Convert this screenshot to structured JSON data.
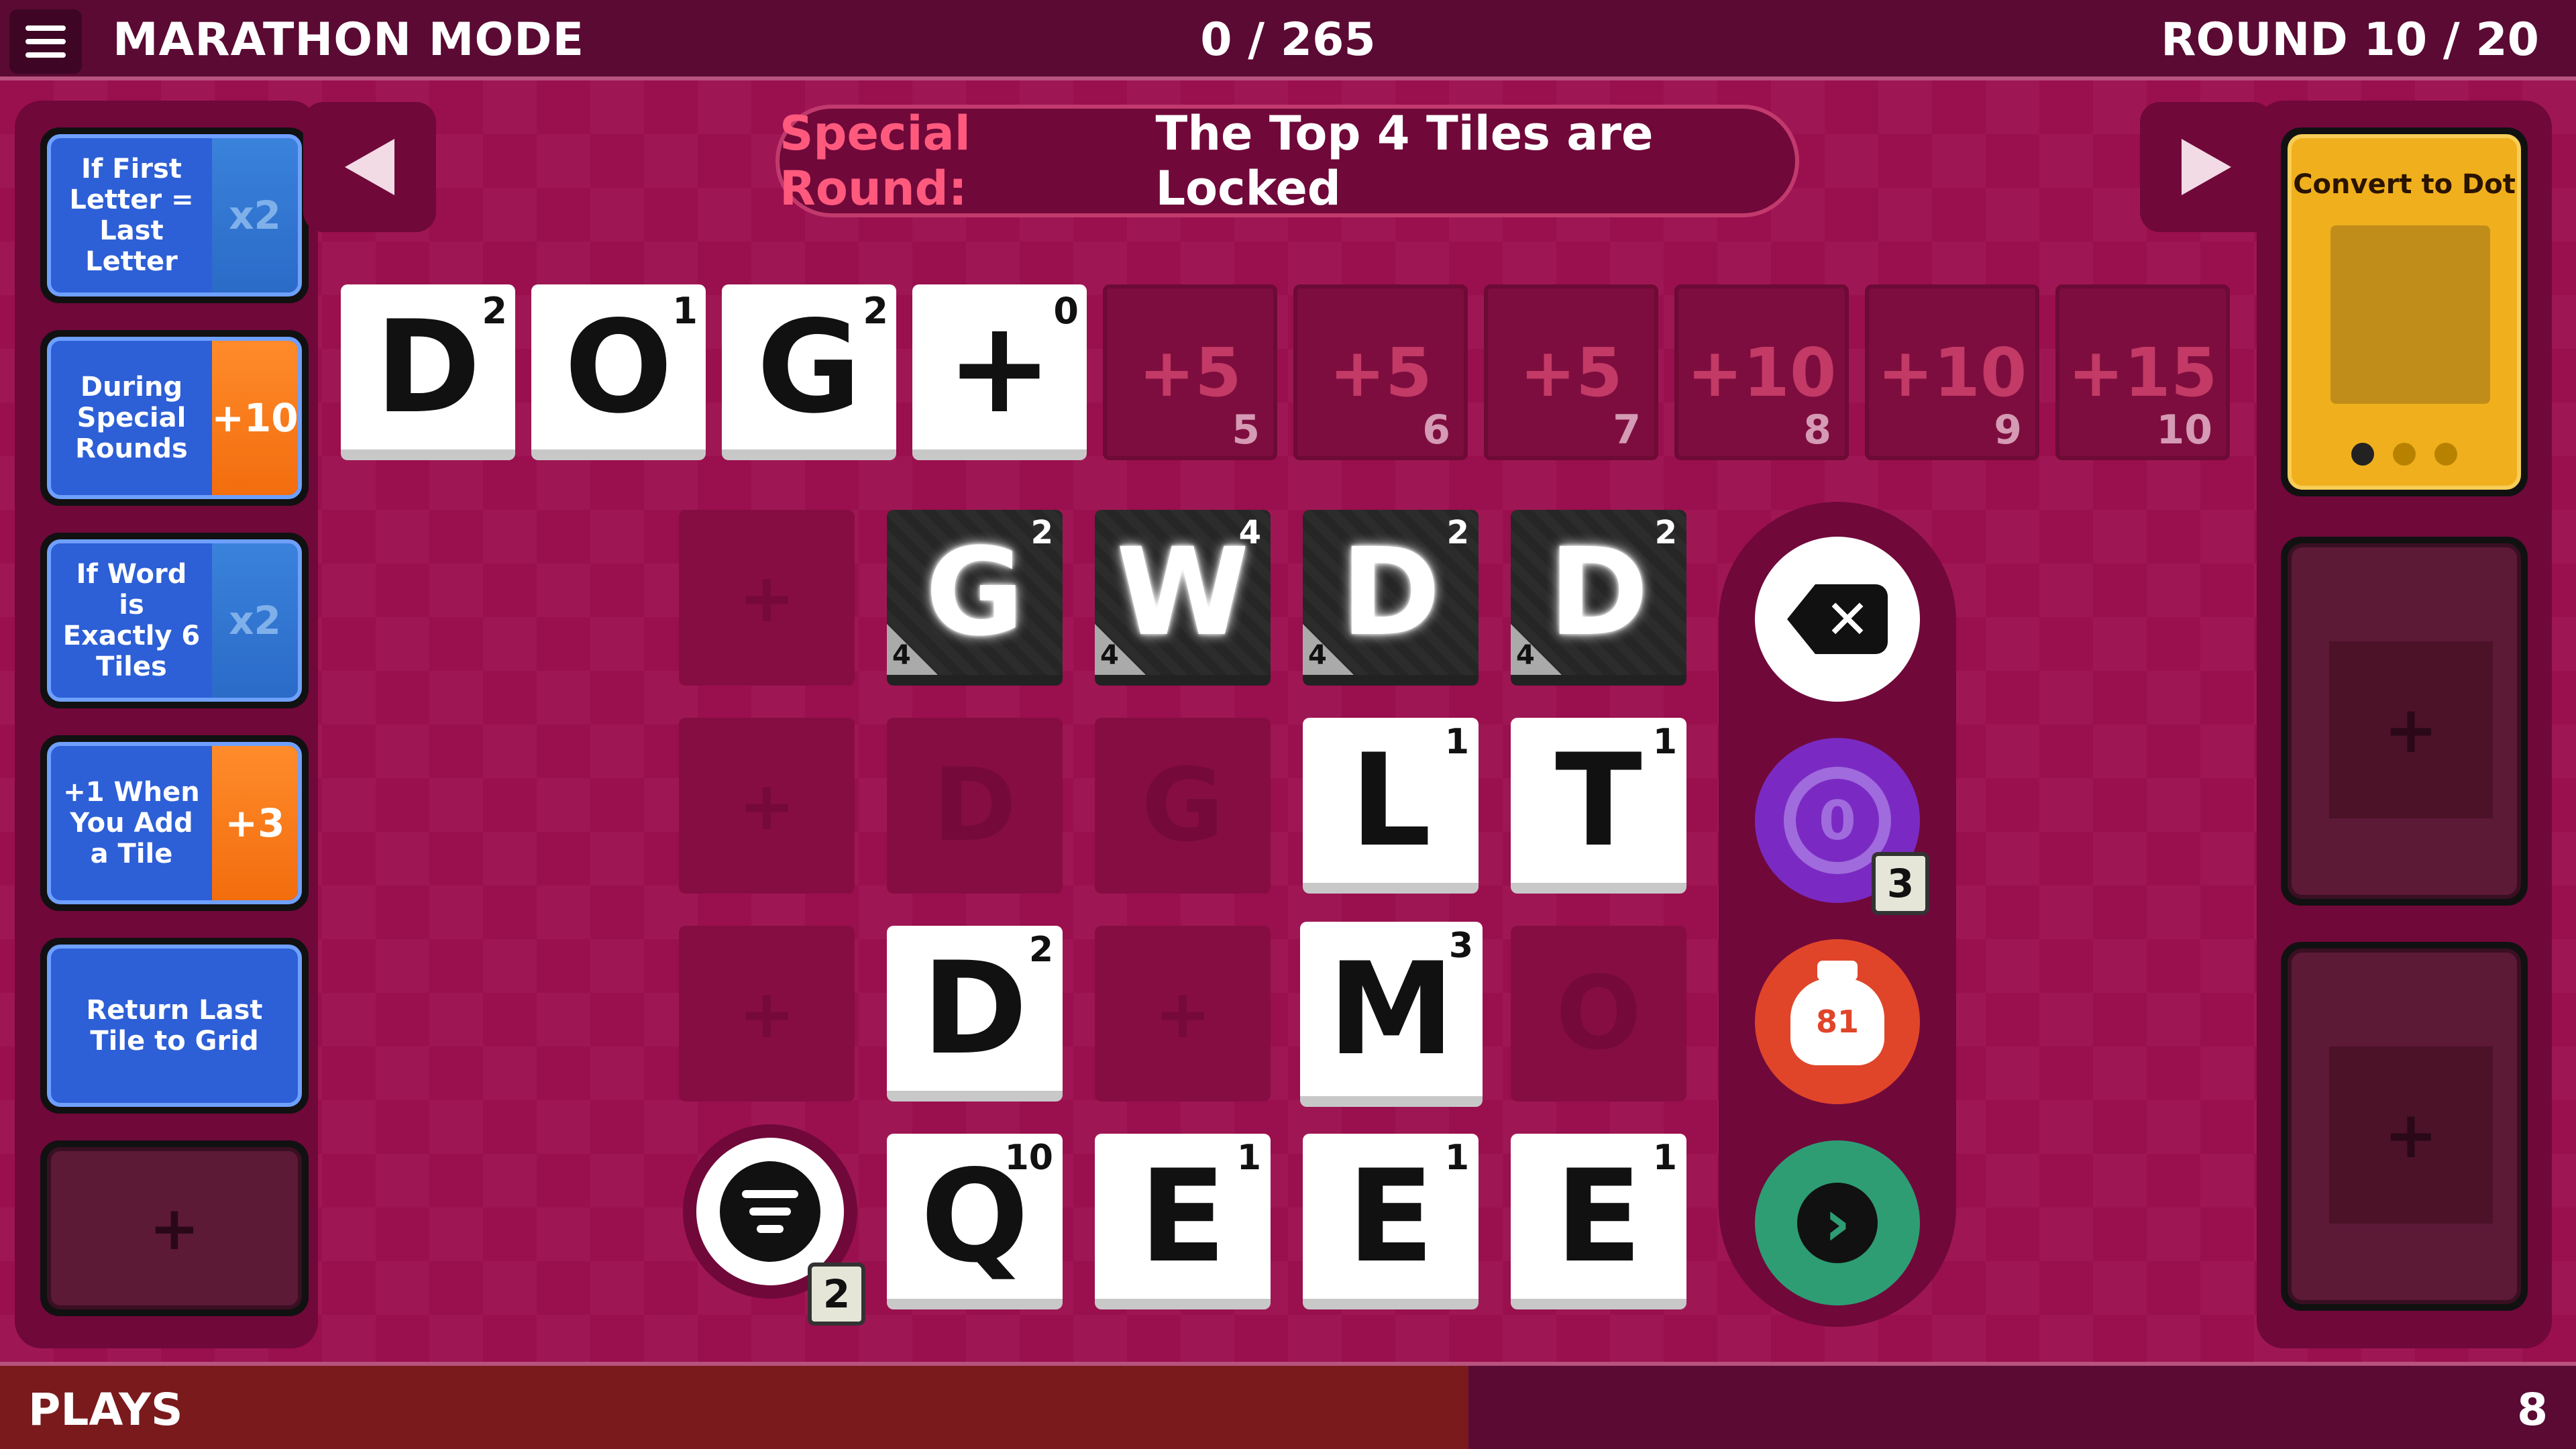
{
  "header": {
    "title": "MARATHON MODE",
    "score": "0 / 265",
    "round": "ROUND 10 / 20"
  },
  "banner": {
    "label": "Special Round:",
    "text": "The Top 4 Tiles are Locked"
  },
  "jokers": [
    {
      "text": "If First Letter = Last Letter",
      "bonus": "x2",
      "color": "blue"
    },
    {
      "text": "During Special Rounds",
      "bonus": "+10",
      "color": "orange"
    },
    {
      "text": "If Word is Exactly 6 Tiles",
      "bonus": "x2",
      "color": "blue"
    },
    {
      "text": "+1 When You Add a Tile",
      "bonus": "+3",
      "color": "orange"
    },
    {
      "text": "Return Last Tile to Grid",
      "bonus": "",
      "color": "blue"
    }
  ],
  "empty_joker_symbol": "+",
  "word": [
    {
      "letter": "D",
      "points": "2"
    },
    {
      "letter": "O",
      "points": "1"
    },
    {
      "letter": "G",
      "points": "2"
    },
    {
      "letter": "+",
      "points": "0"
    }
  ],
  "bonus_slots": [
    {
      "value": "+5",
      "index": "5"
    },
    {
      "value": "+5",
      "index": "6"
    },
    {
      "value": "+5",
      "index": "7"
    },
    {
      "value": "+10",
      "index": "8"
    },
    {
      "value": "+10",
      "index": "9"
    },
    {
      "value": "+15",
      "index": "10"
    }
  ],
  "grid": {
    "locked": [
      {
        "letter": "G",
        "points": "2",
        "lock": "4"
      },
      {
        "letter": "W",
        "points": "4",
        "lock": "4"
      },
      {
        "letter": "D",
        "points": "2",
        "lock": "4"
      },
      {
        "letter": "D",
        "points": "2",
        "lock": "4"
      }
    ],
    "row2": [
      {
        "letter": "L",
        "points": "1"
      },
      {
        "letter": "T",
        "points": "1"
      }
    ],
    "row2_ghosts": [
      "D",
      "G"
    ],
    "row3": [
      {
        "letter": "D",
        "points": "2"
      },
      {
        "letter": "M",
        "points": "3"
      }
    ],
    "row3_ghost": "O",
    "row4": [
      {
        "letter": "Q",
        "points": "10"
      },
      {
        "letter": "E",
        "points": "1"
      },
      {
        "letter": "E",
        "points": "1"
      },
      {
        "letter": "E",
        "points": "1"
      }
    ],
    "plus": "+"
  },
  "controls": {
    "delete_icon": "backspace-icon",
    "redo_value": "0",
    "redo_badge": "3",
    "bag_count": "81",
    "submit_icon": "chevron-right-icon",
    "sort_badge": "2"
  },
  "card": {
    "title": "Convert to Dot",
    "page": 1,
    "pages": 3
  },
  "footer": {
    "label": "PLAYS",
    "value": "8",
    "progress": 0.57
  },
  "colors": {
    "background": "#9a0f4e",
    "panel": "#70083a",
    "joker_blue": "#2d5fd6",
    "joker_orange": "#f26d0e",
    "card_gold": "#f0b01d",
    "banner_label": "#ff5a7d"
  }
}
